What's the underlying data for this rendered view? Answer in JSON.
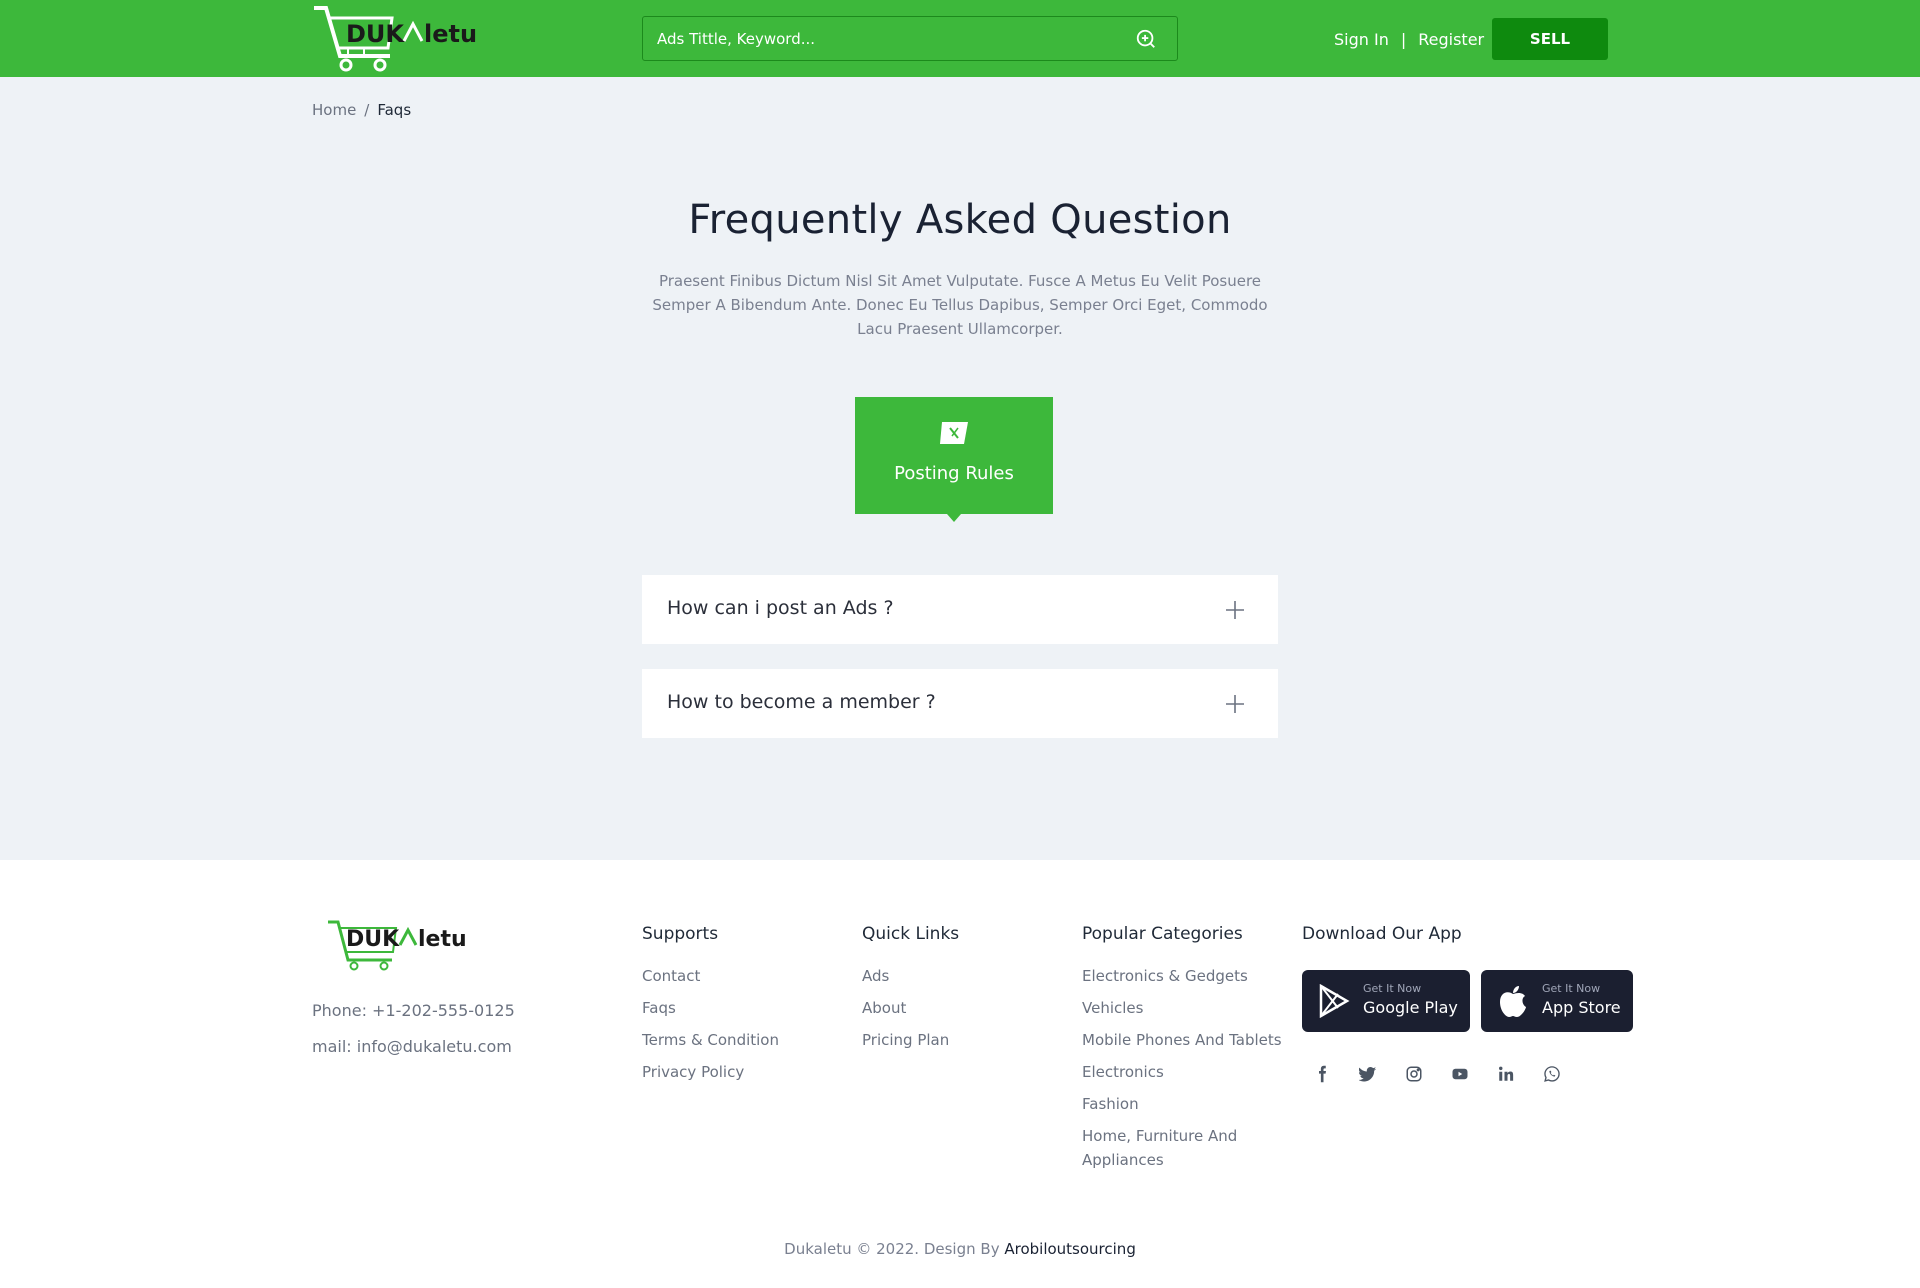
{
  "header": {
    "logo_text": "DUKAletu",
    "search_placeholder": "Ads Tittle, Keyword...",
    "sign_in": "Sign In",
    "nav_separator": "|",
    "register": "Register",
    "sell": "SELL"
  },
  "breadcrumb": {
    "home": "Home",
    "separator": "/",
    "current": "Faqs"
  },
  "faq_page": {
    "title": "Frequently Asked Question",
    "subtitle": "Praesent Finibus Dictum Nisl Sit Amet Vulputate. Fusce A Metus Eu Velit Posuere Semper A Bibendum Ante. Donec Eu Tellus Dapibus, Semper Orci Eget, Commodo Lacu Praesent Ullamcorper.",
    "tab_label": "Posting Rules",
    "tab_icon": "posting-rules-icon",
    "questions": [
      {
        "question": "How can i post an Ads ?",
        "icon": "plus-icon"
      },
      {
        "question": "How to become a member ?",
        "icon": "plus-icon"
      }
    ]
  },
  "footer": {
    "logo_text": "DUKAletu",
    "phone": "Phone: +1-202-555-0125",
    "mail": "mail: info@dukaletu.com",
    "supports": {
      "heading": "Supports",
      "links": [
        "Contact",
        "Faqs",
        "Terms & Condition",
        "Privacy Policy"
      ]
    },
    "quick_links": {
      "heading": "Quick Links",
      "links": [
        "Ads",
        "About",
        "Pricing Plan"
      ]
    },
    "popular_categories": {
      "heading": "Popular Categories",
      "links": [
        "Electronics & Gedgets",
        "Vehicles",
        "Mobile Phones And Tablets",
        "Electronics",
        "Fashion",
        "Home, Furniture And Appliances"
      ]
    },
    "download": {
      "heading": "Download Our App",
      "google_small": "Get It Now",
      "google_big": "Google Play",
      "apple_small": "Get It Now",
      "apple_big": "App Store"
    },
    "socials": [
      "facebook-icon",
      "twitter-icon",
      "instagram-icon",
      "youtube-icon",
      "linkedin-icon",
      "whatsapp-icon"
    ],
    "copyright_text": "Dukaletu © 2022. Design By",
    "designer": "Arobiloutsourcing"
  },
  "colors": {
    "brand_green": "#3db83b",
    "sell_green": "#0e8a0e",
    "page_bg": "#eef2f6",
    "app_button_bg": "#1b1f30"
  }
}
